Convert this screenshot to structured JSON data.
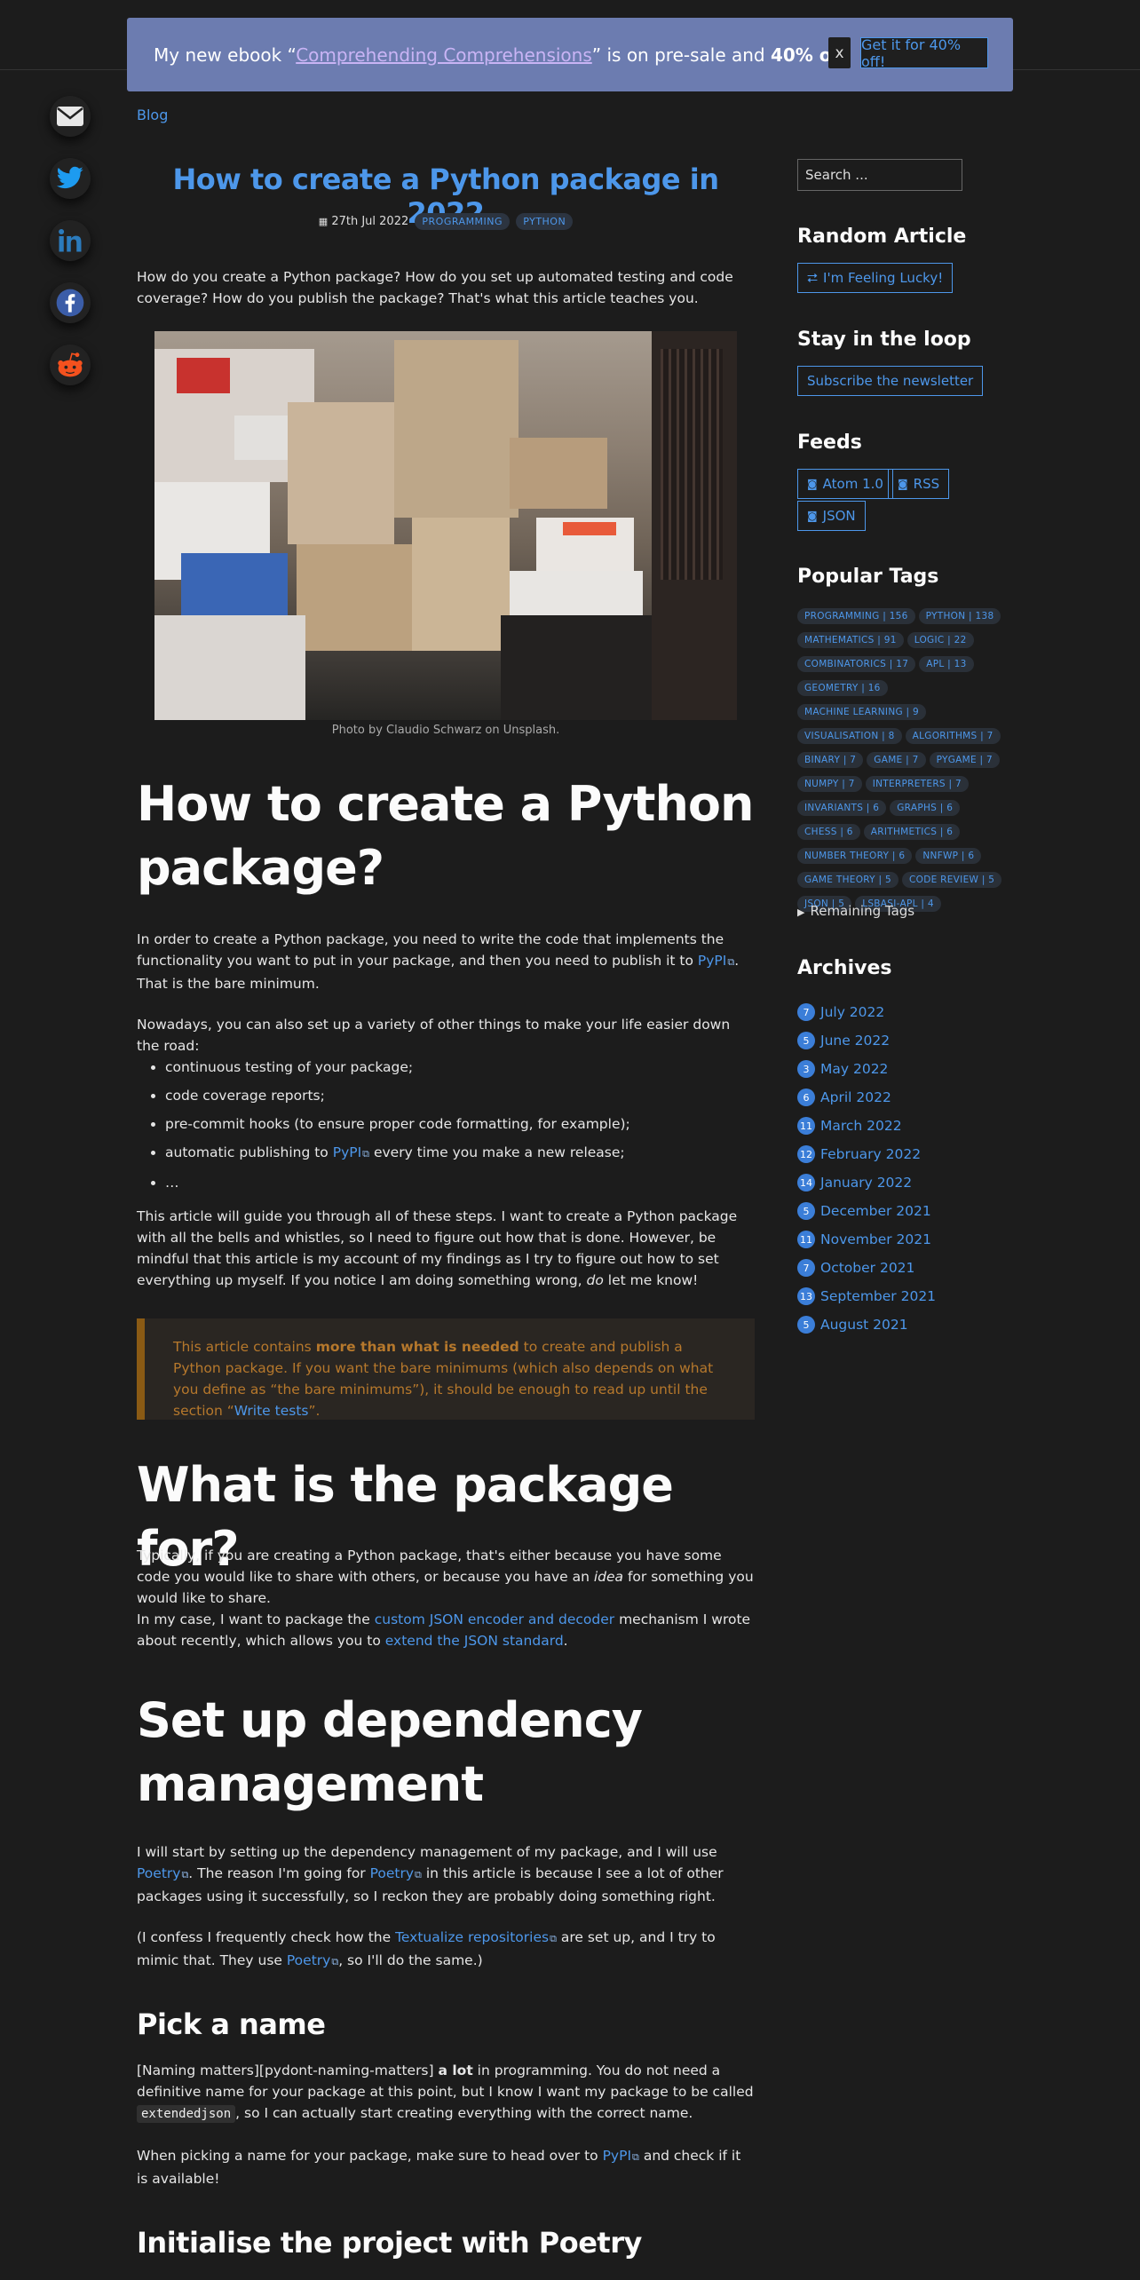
{
  "banner": {
    "text_before": "My new ebook “",
    "ebook_link": "Comprehending Comprehensions",
    "text_middle": "” is on pre-sale and ",
    "discount": "40% off",
    "text_after": "!",
    "close_label": "x",
    "cta_label": "Get it for 40% off!"
  },
  "share": [
    "email-icon",
    "twitter-icon",
    "linkedin-icon",
    "facebook-icon",
    "reddit-icon"
  ],
  "breadcrumb": "Blog",
  "post": {
    "title": "How to create a Python package in 2022",
    "date_icon": "📅",
    "date": "27th Jul 2022",
    "tags": [
      "PROGRAMMING",
      "PYTHON"
    ],
    "intro": "How do you create a Python package? How do you set up automated testing and code coverage? How do you publish the package? That's what this article teaches you.",
    "photo_caption": "Photo by Claudio Schwarz on Unsplash."
  },
  "sections": {
    "h_create": "How to create a Python package?",
    "p1_a": "In order to create a Python package, you need to write the code that implements the functionality you want to put in your package, and then you need to publish it to ",
    "p1_link": "PyPI",
    "p1_b": ". That is the bare minimum.",
    "p2": "Nowadays, you can also set up a variety of other things to make your life easier down the road:",
    "bullets": [
      "continuous testing of your package;",
      "code coverage reports;",
      "pre-commit hooks (to ensure proper code formatting, for example);",
      "automatic publishing to ",
      "…"
    ],
    "bullet4_link": "PyPI",
    "bullet4_after": " every time you make a new release;",
    "p3_a": "This article will guide you through all of these steps. I want to create a Python package with all the bells and whistles, so I need to figure out how that is done. However, be mindful that this article is my account of my findings as I try to figure out how to set everything up myself. If you notice I am doing something wrong, ",
    "p3_em": "do",
    "p3_b": " let me know!",
    "note_a": "This article contains ",
    "note_bold": "more than what is needed",
    "note_b": " to create and publish a Python package. If you want the bare minimums (which also depends on what you define as “the bare minimums”), it should be enough to read up until the section “",
    "note_link": "Write tests",
    "note_c": "”.",
    "h_what": "What is the package for?",
    "p4_a": "Typically, if you are creating a Python package, that's either because you have some code you would like to share with others, or because you have an ",
    "p4_em": "idea",
    "p4_b": " for something you would like to share.",
    "p5_a": "In my case, I want to package the ",
    "p5_link1": "custom JSON encoder and decoder",
    "p5_b": " mechanism I wrote about recently, which allows you to ",
    "p5_link2": "extend the JSON standard",
    "p5_c": ".",
    "h_dep": "Set up dependency management",
    "p6_a": "I will start by setting up the dependency management of my package, and I will use ",
    "p6_link1": "Poetry",
    "p6_b": ". The reason I'm going for ",
    "p6_link2": "Poetry",
    "p6_c": " in this article is because I see a lot of other packages using it successfully, so I reckon they are probably doing something right.",
    "p7_a": "(I confess I frequently check how the ",
    "p7_link1": "Textualize repositories",
    "p7_b": " are set up, and I try to mimic that. They use ",
    "p7_link2": "Poetry",
    "p7_c": ", so I'll do the same.)",
    "h_name": "Pick a name",
    "p8_a": "[Naming matters][pydont-naming-matters] ",
    "p8_bold": "a lot",
    "p8_b": " in programming. You do not need a definitive name for your package at this point, but I know I want my package to be called ",
    "p8_code": "extendedjson",
    "p8_c": ", so I can actually start creating everything with the correct name.",
    "p9_a": "When picking a name for your package, make sure to head over to ",
    "p9_link": "PyPI",
    "p9_b": " and check if it is available!",
    "h_init": "Initialise the project with Poetry"
  },
  "sidebar": {
    "search_placeholder": "Search ...",
    "random_heading": "Random Article",
    "random_button": "I'm Feeling Lucky!",
    "loop_heading": "Stay in the loop",
    "subscribe_button": "Subscribe the newsletter",
    "feeds_heading": "Feeds",
    "feeds": [
      "Atom 1.0",
      "RSS",
      "JSON"
    ],
    "tags_heading": "Popular Tags",
    "tags": [
      "PROGRAMMING | 156",
      "PYTHON | 138",
      "MATHEMATICS | 91",
      "LOGIC | 22",
      "COMBINATORICS | 17",
      "APL | 13",
      "GEOMETRY | 16",
      "MACHINE LEARNING | 9",
      "VISUALISATION | 8",
      "ALGORITHMS | 7",
      "BINARY | 7",
      "GAME | 7",
      "PYGAME | 7",
      "NUMPY | 7",
      "INTERPRETERS | 7",
      "INVARIANTS | 6",
      "GRAPHS | 6",
      "CHESS | 6",
      "ARITHMETICS | 6",
      "NUMBER THEORY | 6",
      "NNFWP | 6",
      "GAME THEORY | 5",
      "CODE REVIEW | 5",
      "JSON | 5",
      "LSBASI-APL | 4"
    ],
    "remaining_tags": "Remaining Tags",
    "archives_heading": "Archives",
    "archives": [
      {
        "count": "7",
        "label": "July 2022"
      },
      {
        "count": "5",
        "label": "June 2022"
      },
      {
        "count": "3",
        "label": "May 2022"
      },
      {
        "count": "6",
        "label": "April 2022"
      },
      {
        "count": "11",
        "label": "March 2022"
      },
      {
        "count": "12",
        "label": "February 2022"
      },
      {
        "count": "14",
        "label": "January 2022"
      },
      {
        "count": "5",
        "label": "December 2021"
      },
      {
        "count": "11",
        "label": "November 2021"
      },
      {
        "count": "7",
        "label": "October 2021"
      },
      {
        "count": "13",
        "label": "September 2021"
      },
      {
        "count": "5",
        "label": "August 2021"
      }
    ]
  },
  "colors": {
    "background": "#1c1c1c",
    "link": "#4d97ea",
    "banner": "#6c7cb0",
    "note_text": "#b6782c",
    "note_border": "#8a5a14"
  }
}
